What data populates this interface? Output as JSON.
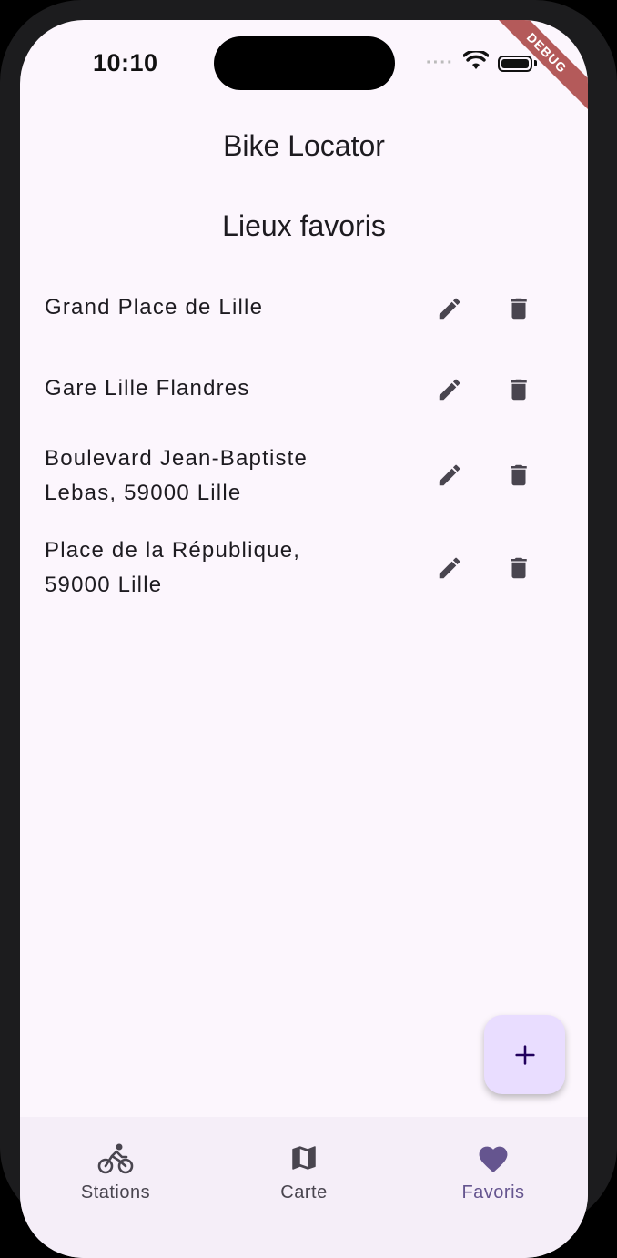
{
  "status_bar": {
    "time": "10:10",
    "debug_label": "DEBUG"
  },
  "app_bar": {
    "title": "Bike Locator"
  },
  "section": {
    "title": "Lieux favoris"
  },
  "favorites": [
    {
      "label": "Grand Place de Lille"
    },
    {
      "label": "Gare Lille Flandres"
    },
    {
      "label": "Boulevard Jean-Baptiste Lebas, 59000 Lille"
    },
    {
      "label": "Place de la République, 59000 Lille"
    }
  ],
  "fab": {
    "icon": "plus-icon"
  },
  "bottom_nav": {
    "items": [
      {
        "label": "Stations",
        "icon": "bike-icon",
        "active": false
      },
      {
        "label": "Carte",
        "icon": "map-icon",
        "active": false
      },
      {
        "label": "Favoris",
        "icon": "heart-icon",
        "active": true
      }
    ]
  },
  "colors": {
    "background": "#fcf6fd",
    "text": "#1d1b20",
    "icon": "#49454f",
    "accent": "#65558f",
    "fab_bg": "#e9ddff",
    "debug_banner": "#b45a5a"
  }
}
